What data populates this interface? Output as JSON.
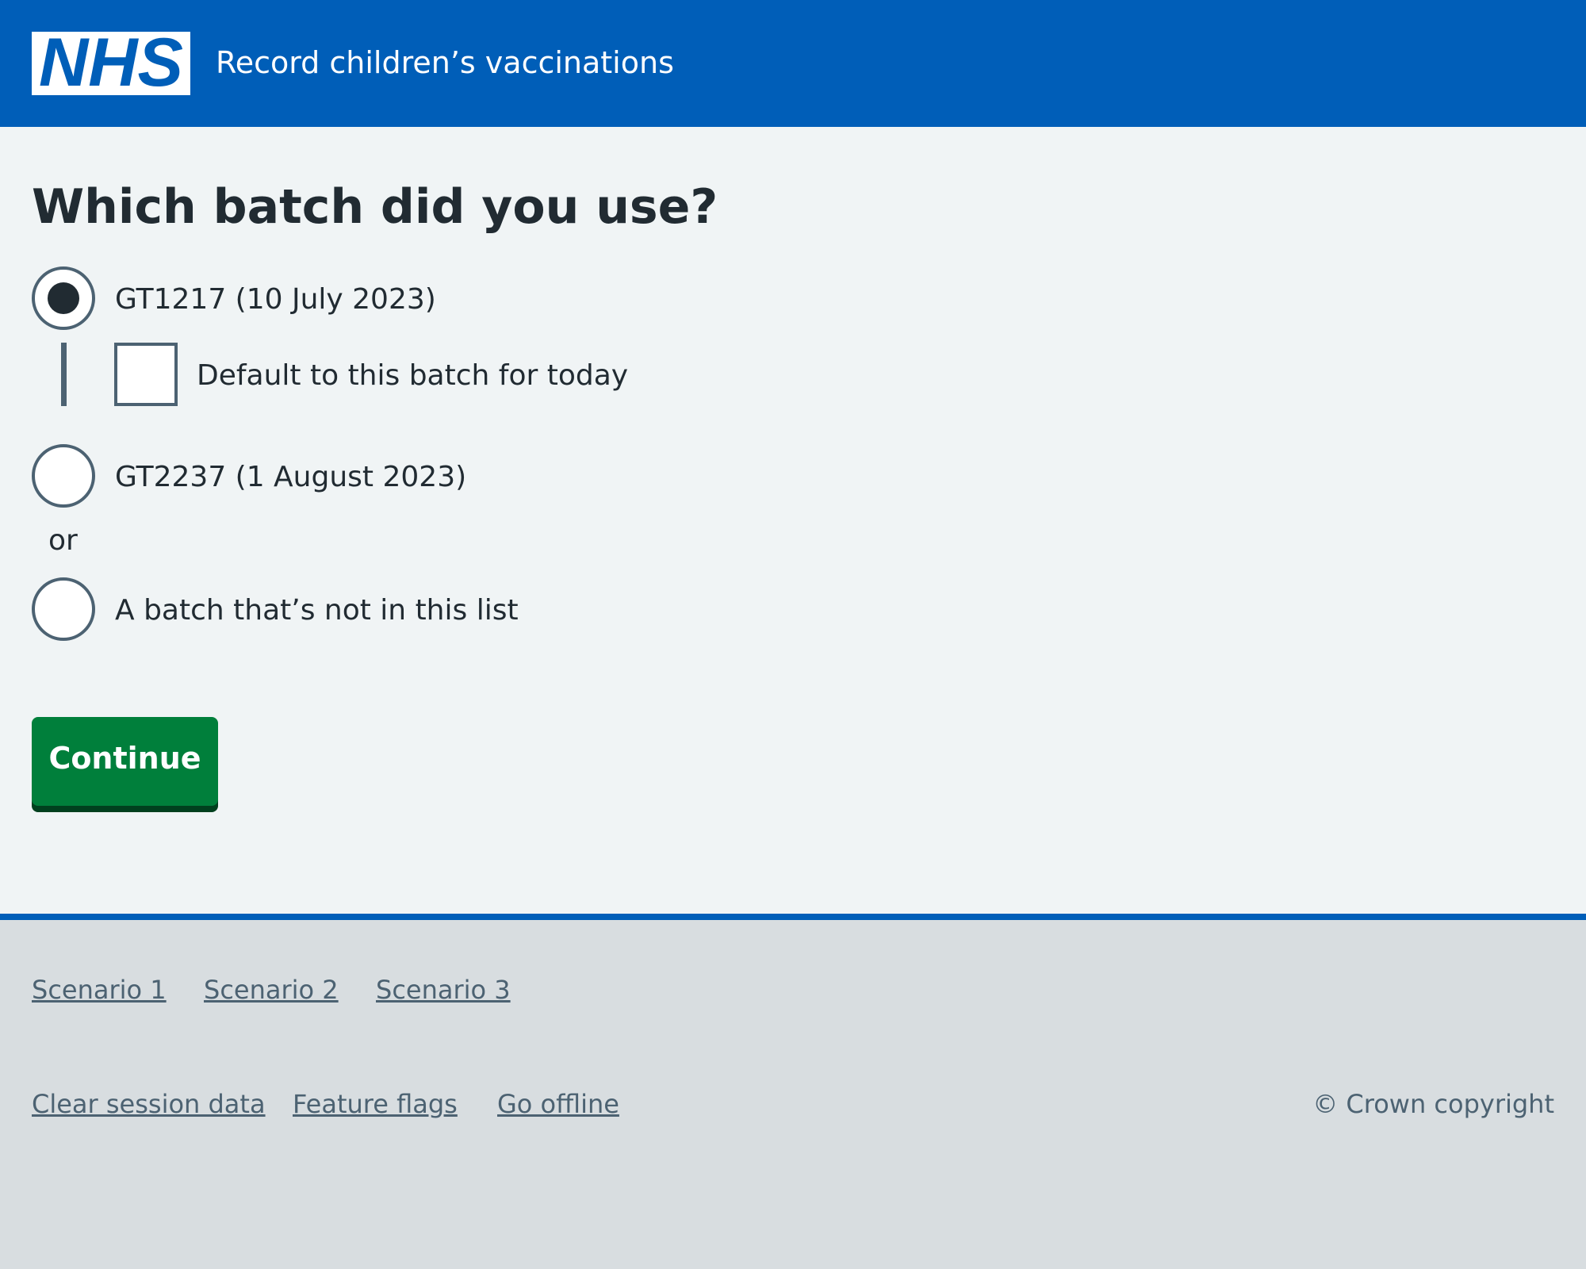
{
  "header": {
    "logo_text": "NHS",
    "service_name": "Record children’s vaccinations",
    "brand_color": "#005eb8"
  },
  "form": {
    "title": "Which batch did you use?",
    "options": [
      {
        "label": "GT1217 (10 July 2023)",
        "checked": true
      },
      {
        "label": "GT2237 (1 August 2023)",
        "checked": false
      },
      {
        "label": "A batch that’s not in this list",
        "checked": false
      }
    ],
    "default_checkbox": {
      "label": "Default to this batch for today",
      "checked": false
    },
    "divider_text": "or",
    "continue_label": "Continue",
    "button_color": "#007f3b"
  },
  "footer": {
    "scenario_links": [
      "Scenario 1",
      "Scenario 2",
      "Scenario 3"
    ],
    "utility_links": [
      "Clear session data",
      "Feature flags",
      "Go offline"
    ],
    "copyright": "© Crown copyright"
  }
}
